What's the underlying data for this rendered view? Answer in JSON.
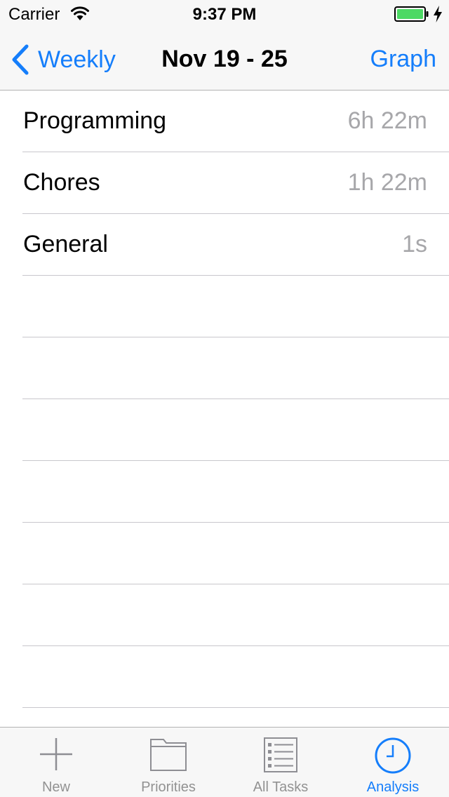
{
  "status_bar": {
    "carrier": "Carrier",
    "time": "9:37 PM",
    "icons": [
      "wifi-icon",
      "battery-icon",
      "charging-icon"
    ],
    "battery_color": "#4cd964"
  },
  "nav": {
    "back_label": "Weekly",
    "title": "Nov 19 - 25",
    "right_label": "Graph"
  },
  "rows": [
    {
      "title": "Programming",
      "value": "6h 22m"
    },
    {
      "title": "Chores",
      "value": "1h 22m"
    },
    {
      "title": "General",
      "value": "1s"
    }
  ],
  "tabs": [
    {
      "label": "New",
      "icon": "plus-icon",
      "active": false
    },
    {
      "label": "Priorities",
      "icon": "folder-icon",
      "active": false
    },
    {
      "label": "All Tasks",
      "icon": "list-icon",
      "active": false
    },
    {
      "label": "Analysis",
      "icon": "clock-icon",
      "active": true
    }
  ],
  "colors": {
    "accent": "#157efb",
    "secondary_text": "#a7a7aa",
    "inactive_tab": "#929292",
    "separator": "#c8c7cc",
    "bar_background": "#f7f7f7"
  }
}
